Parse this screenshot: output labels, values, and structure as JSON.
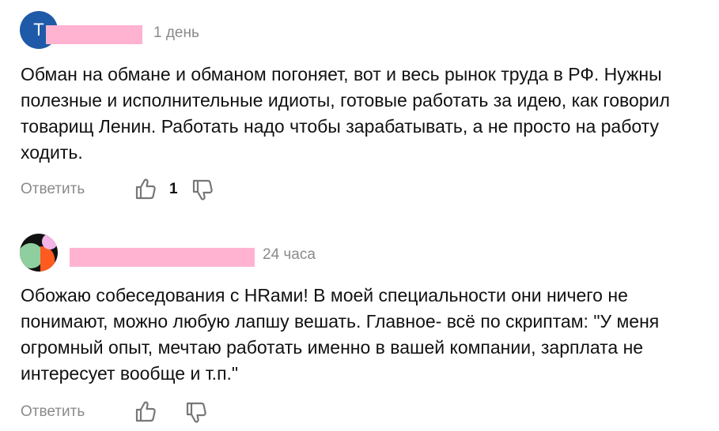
{
  "comments": [
    {
      "avatar_letter": "T",
      "time": "1 день",
      "text": "Обман на обмане и обманом погоняет, вот и весь рынок труда в РФ. Нужны полезные и исполнительные идиоты, готовые работать за идею, как говорил товарищ Ленин. Работать надо чтобы зарабатывать, а не просто на работу ходить.",
      "reply_label": "Ответить",
      "like_count": "1",
      "avatar_color": "#1e5aa8"
    },
    {
      "time": "24 часа",
      "text": "Обожаю собеседования с HRами! В моей специальности они ничего не понимают, можно любую лапшу вешать. Главное- всё по скриптам: \"У меня огромный опыт, мечтаю работать именно в вашей компании, зарплата не интересует вообще и т.п.\"",
      "reply_label": "Ответить",
      "avatar_colors": [
        "#111111",
        "#8fcf9f",
        "#ff5a1f",
        "#f3b6e6"
      ]
    }
  ],
  "icons": {
    "like": "thumb-up-icon",
    "dislike": "thumb-down-icon"
  },
  "colors": {
    "redaction": "#ffb3d1",
    "muted_text": "#8a8a8a"
  }
}
